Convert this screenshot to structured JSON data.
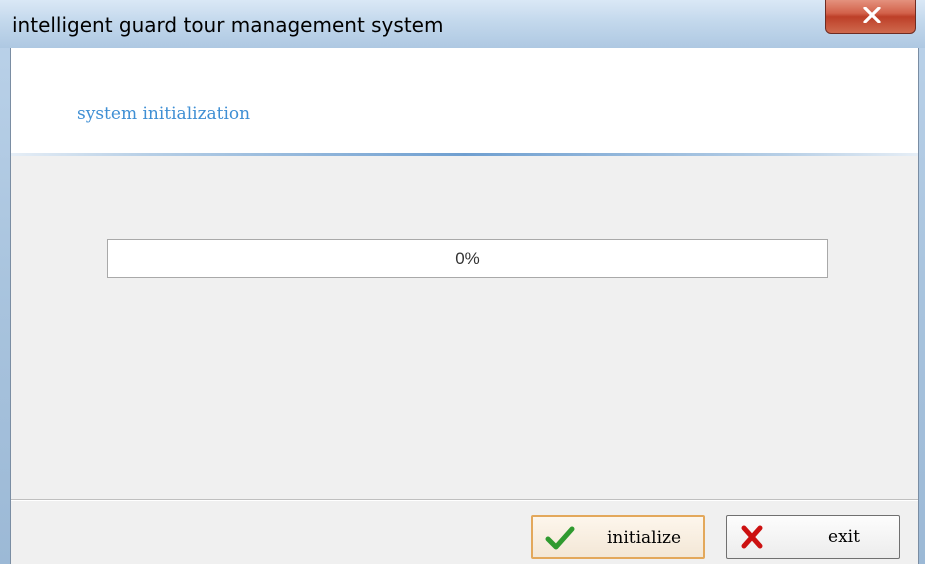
{
  "window": {
    "title": "intelligent guard tour management system"
  },
  "header": {
    "title": "system initialization"
  },
  "progress": {
    "value": 0,
    "label": "0%"
  },
  "buttons": {
    "initialize_label": "initialize",
    "initialize_icon": "checkmark-icon",
    "exit_label": "exit",
    "exit_icon": "x-icon"
  },
  "colors": {
    "accent_text": "#3f8fd4",
    "check_green": "#2f9a2f",
    "x_red": "#cc1111",
    "close_red": "#c9533b",
    "focus_orange": "#e3a85b"
  }
}
